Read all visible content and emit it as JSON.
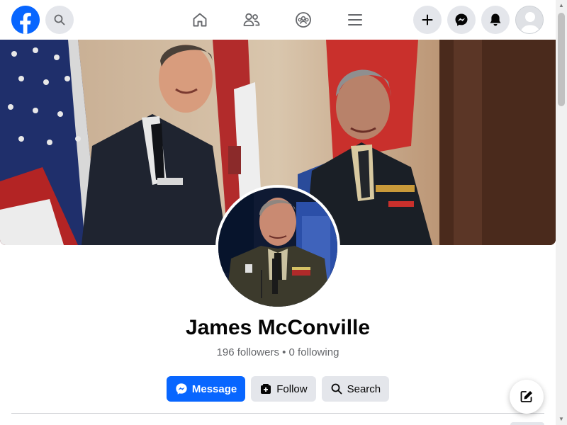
{
  "app": {
    "brand_color": "#0866ff"
  },
  "nav": {
    "logo_icon": "facebook-logo-icon",
    "search_icon": "search-icon",
    "center": [
      {
        "name": "home",
        "icon": "home-icon"
      },
      {
        "name": "friends",
        "icon": "friends-icon"
      },
      {
        "name": "groups",
        "icon": "groups-icon"
      },
      {
        "name": "menu",
        "icon": "menu-icon"
      }
    ],
    "right": [
      {
        "name": "create",
        "icon": "plus-icon"
      },
      {
        "name": "messenger",
        "icon": "messenger-icon"
      },
      {
        "name": "notifications",
        "icon": "bell-icon"
      },
      {
        "name": "account",
        "icon": "avatar-icon"
      }
    ]
  },
  "profile": {
    "name": "James McConville",
    "stats": "196 followers • 0 following"
  },
  "actions": {
    "message": "Message",
    "follow": "Follow",
    "search": "Search"
  },
  "fab": {
    "icon": "compose-icon"
  }
}
